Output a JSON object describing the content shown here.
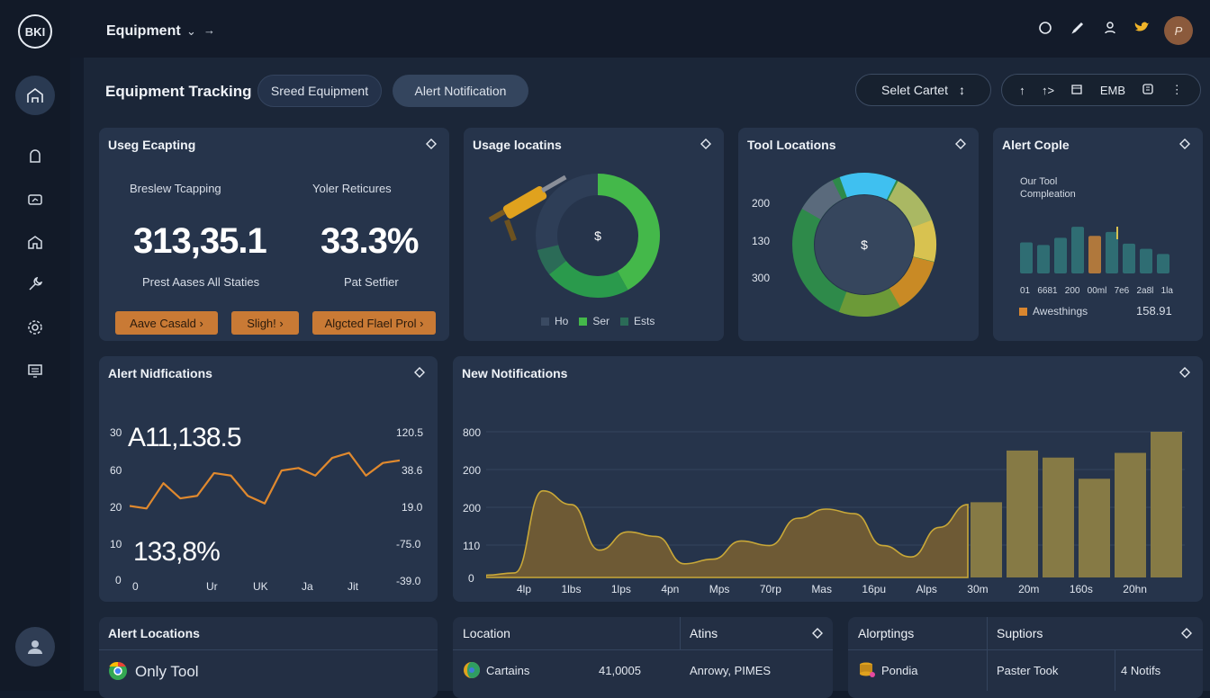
{
  "app": {
    "logo_text": "BKI"
  },
  "topbar": {
    "title": "Equipment",
    "arrow": "→"
  },
  "page": {
    "title": "Equipment Tracking",
    "tabs": [
      {
        "label": "Sreed Equipment"
      },
      {
        "label": "Alert Notification"
      }
    ],
    "select": {
      "label": "Selet Cartet",
      "caret": "↕"
    },
    "toolbar": {
      "btn1": "↑",
      "btn2": "↑>",
      "btn4": "EMB"
    }
  },
  "cards": {
    "usage_tracking": {
      "title": "Useg Ecapting",
      "left_label": "Breslew Tcapping",
      "right_label": "Yoler Reticures",
      "left_value": "313,35.1",
      "right_value": "33.3%",
      "left_sub": "Prest Aases All Staties",
      "right_sub": "Pat Setfier",
      "buttons": [
        "Aave Casald",
        "Sligh!",
        "Algcted Flael Prol"
      ]
    },
    "usage_locations": {
      "title": "Usage locatins",
      "center": "$",
      "legend": [
        "Ho",
        "Ser",
        "Ests"
      ]
    },
    "tool_locations": {
      "title": "Tool Locations",
      "center": "$",
      "y_labels": [
        "200",
        "130",
        "300"
      ]
    },
    "alert_couple": {
      "title": "Alert Cople",
      "subtitle": "Our Tool Compleation",
      "x_labels": [
        "01",
        "6681",
        "200",
        "00ml",
        "7e6",
        "2a8l",
        "1la"
      ],
      "legend_label": "Awesthings",
      "legend_value": "158.91",
      "bars": [
        0.48,
        0.44,
        0.55,
        0.72,
        0.58,
        0.64,
        0.46,
        0.38,
        0.3
      ],
      "bar_colors": [
        "#2f6d73",
        "#2f6d73",
        "#2f6d73",
        "#2f6d73",
        "#b0783c",
        "#2f6d73",
        "#2f6d73",
        "#2f6d73",
        "#2f6d73"
      ]
    },
    "alert_notifications": {
      "title": "Alert Nidfications",
      "value_top": "A11,138.5",
      "value_bottom": "133,8%",
      "y_left": [
        "30",
        "60",
        "20",
        "10",
        "0"
      ],
      "y_right": [
        "120.5",
        "38.6",
        "19.0",
        "-75.0",
        "-39.0"
      ],
      "x_labels": [
        "0",
        "Ur",
        "UK",
        "Ja",
        "Jit"
      ]
    },
    "new_notifications": {
      "title": "New Notifications",
      "y_labels": [
        "800",
        "200",
        "200",
        "110",
        "0"
      ],
      "x_labels": [
        "4lp",
        "1lbs",
        "1lps",
        "4pn",
        "Mps",
        "70rp",
        "Mas",
        "16pu",
        "Alps",
        "30m",
        "20m",
        "160s",
        "20hn"
      ]
    }
  },
  "chart_data": [
    {
      "type": "line",
      "x": [
        "0",
        "Ur",
        "UK",
        "Ja",
        "Jit"
      ],
      "values": [
        18,
        17,
        27,
        21,
        22,
        31,
        30,
        22,
        19,
        32,
        33,
        30,
        37,
        39,
        30,
        35,
        36
      ]
    },
    {
      "type": "area",
      "x": [
        "4lp",
        "1lbs",
        "1lps",
        "4pn",
        "Mps",
        "70rp",
        "Mas",
        "16pu",
        "Alps",
        "30m",
        "20m",
        "160s",
        "20hn"
      ],
      "series": [
        {
          "values": [
            5,
            10,
            190,
            160,
            60,
            100,
            90,
            30,
            40,
            80,
            70,
            130,
            150,
            140,
            70,
            45,
            110,
            160
          ]
        },
        {
          "values": [
            0,
            0,
            0,
            0,
            0,
            0,
            0,
            0,
            0,
            0,
            0,
            0,
            0,
            0,
            0,
            0,
            0,
            160,
            270,
            255,
            210,
            265,
            310
          ]
        }
      ]
    }
  ],
  "tables": {
    "alert_locations": {
      "title": "Alert Locations",
      "rows": [
        {
          "name": "Only Tool"
        }
      ]
    },
    "location": {
      "headers": [
        "Location",
        "Atins"
      ],
      "rows": [
        {
          "name": "Cartains",
          "count": "41,0005",
          "value": "Anrowy, PIMES"
        }
      ]
    },
    "alerts": {
      "headers": [
        "Alorptings",
        "Suptiors"
      ],
      "rows": [
        {
          "name": "Pondia",
          "value": "Paster Took",
          "count": "4 Notifs"
        }
      ]
    }
  }
}
